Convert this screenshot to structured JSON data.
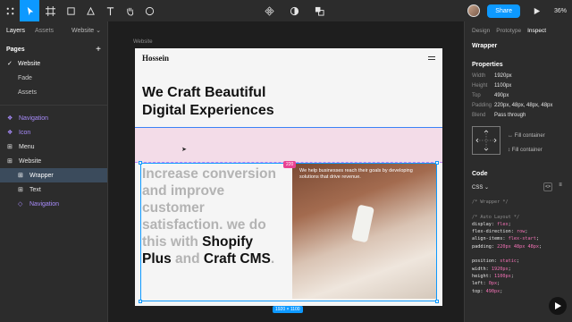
{
  "toolbar": {
    "share_label": "Share",
    "zoom_label": "36%"
  },
  "left_panel": {
    "tabs": [
      "Layers",
      "Assets"
    ],
    "site_label": "Website",
    "pages_title": "Pages",
    "add_label": "+",
    "pages": [
      {
        "label": "Website",
        "current": true
      },
      {
        "label": "Fade",
        "current": false
      },
      {
        "label": "Assets",
        "current": false
      }
    ],
    "layers": [
      {
        "label": "Navigation",
        "kind": "component"
      },
      {
        "label": "Icon",
        "kind": "component"
      },
      {
        "label": "Menu",
        "kind": "frame"
      },
      {
        "label": "Website",
        "kind": "frame"
      },
      {
        "label": "Wrapper",
        "kind": "frame"
      },
      {
        "label": "Text",
        "kind": "frame"
      },
      {
        "label": "Navigation",
        "kind": "component"
      }
    ]
  },
  "canvas": {
    "frame_label": "Website",
    "logo_text": "Hossein",
    "headline_line1": "We Craft Beautiful",
    "headline_line2": "Digital Experiences",
    "body_p1": "Increase conversion and improve customer satisfaction. we do this with ",
    "body_shopify": "Shopify",
    "body_plus": "Plus",
    "body_and": " and ",
    "body_craft": "Craft CMS",
    "body_end": ".",
    "photo_caption": "We help businesses reach their goals by developing solutions that drive revenue.",
    "selection_tag": "220",
    "dimension_tag": "1920 × 1100"
  },
  "right_panel": {
    "tabs": [
      "Design",
      "Prototype",
      "Inspect"
    ],
    "selected_name": "Wrapper",
    "properties_title": "Properties",
    "props": [
      {
        "k": "Width",
        "v": "1920px"
      },
      {
        "k": "Height",
        "v": "1100px"
      },
      {
        "k": "Top",
        "v": "490px"
      },
      {
        "k": "Padding",
        "v": "220px, 48px, 48px, 48px"
      },
      {
        "k": "Blend",
        "v": "Pass through"
      }
    ],
    "fill_1": "Fill container",
    "fill_2": "Fill container",
    "code_title": "Code",
    "code_lang": "CSS",
    "code_lines": [
      {
        "t": "/* Wrapper */",
        "c": "cm"
      },
      {
        "t": "",
        "c": "blank"
      },
      {
        "t": "/* Auto Layout */",
        "c": "cm"
      },
      {
        "p": "display: ",
        "v": "flex",
        "e": ";"
      },
      {
        "p": "flex-direction: ",
        "v": "row",
        "e": ";"
      },
      {
        "p": "align-items: ",
        "v": "flex-start",
        "e": ";"
      },
      {
        "p": "padding: ",
        "v": "220px 48px 48px",
        "e": ";"
      },
      {
        "t": "",
        "c": "blank"
      },
      {
        "p": "position: ",
        "v": "static",
        "e": ";"
      },
      {
        "p": "width: ",
        "v": "1920px",
        "e": ";"
      },
      {
        "p": "height: ",
        "v": "1100px",
        "e": ";"
      },
      {
        "p": "left: ",
        "v": "0px",
        "e": ";"
      },
      {
        "p": "top: ",
        "v": "490px",
        "e": ";"
      }
    ]
  }
}
